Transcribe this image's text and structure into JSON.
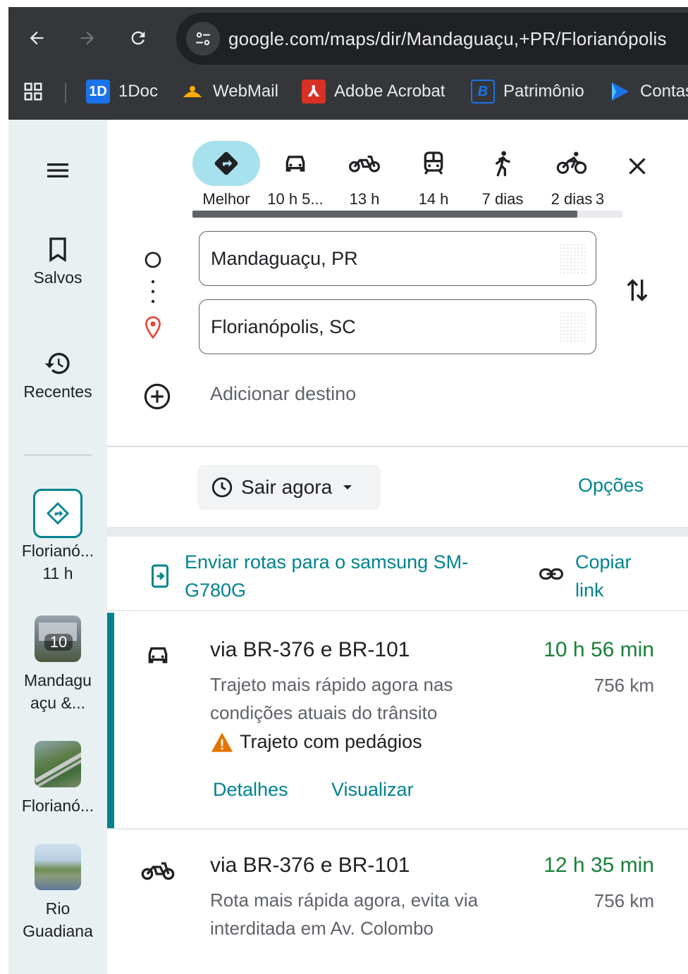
{
  "browser": {
    "url": "google.com/maps/dir/Mandaguaçu,+PR/Florianópolis",
    "bookmarks": [
      {
        "label": "1Doc",
        "icon": "1doc-icon",
        "color": "#1a73e8"
      },
      {
        "label": "WebMail",
        "icon": "webmail-icon",
        "color": "#f9ab00"
      },
      {
        "label": "Adobe Acrobat",
        "icon": "acrobat-icon",
        "color": "#d93025"
      },
      {
        "label": "Patrimônio",
        "icon": "patrimonio-icon",
        "color": "#1a73e8"
      },
      {
        "label": "Contas",
        "icon": "contas-icon",
        "color": "#1a73e8"
      }
    ]
  },
  "rail": {
    "saved_label": "Salvos",
    "recent_label": "Recentes",
    "recents": [
      {
        "line1": "Florianó...",
        "line2": "11 h"
      },
      {
        "line1": "Mandagu",
        "line2": "açu &...",
        "badge": "10"
      },
      {
        "line1": "Florianó...",
        "line2": ""
      },
      {
        "line1": "Rio",
        "line2": "Guadiana"
      }
    ]
  },
  "modes": [
    {
      "label": "Melhor",
      "icon": "best-route-icon",
      "active": true
    },
    {
      "label": "10 h 5...",
      "icon": "car-icon"
    },
    {
      "label": "13 h",
      "icon": "motorcycle-icon"
    },
    {
      "label": "14 h",
      "icon": "transit-icon"
    },
    {
      "label": "7 dias",
      "icon": "walk-icon"
    },
    {
      "label": "2 dias",
      "icon": "bicycle-icon"
    },
    {
      "label": "3",
      "icon": "flight-icon"
    }
  ],
  "origin": "Mandaguaçu, PR",
  "destination": "Florianópolis, SC",
  "add_destination": "Adicionar destino",
  "depart_label": "Sair agora",
  "options_label": "Opções",
  "send_to_device": "Enviar rotas para o samsung SM-G780G",
  "copy_link": "Copiar link",
  "routes": [
    {
      "mode_icon": "car-icon",
      "title": "via BR-376 e BR-101",
      "time": "10 h 56 min",
      "distance": "756 km",
      "description": "Trajeto mais rápido agora nas condições atuais do trânsito",
      "warning": "Trajeto com pedágios",
      "details_label": "Detalhes",
      "preview_label": "Visualizar"
    },
    {
      "mode_icon": "motorcycle-icon",
      "title": "via BR-376 e BR-101",
      "time": "12 h 35 min",
      "distance": "756 km",
      "description": "Rota mais rápida agora, evita via interditada em Av. Colombo"
    }
  ],
  "colors": {
    "accent": "#00838f",
    "time_green": "#188038",
    "chip_active": "#a8e1ee",
    "rail_bg": "#e8f0f2"
  }
}
